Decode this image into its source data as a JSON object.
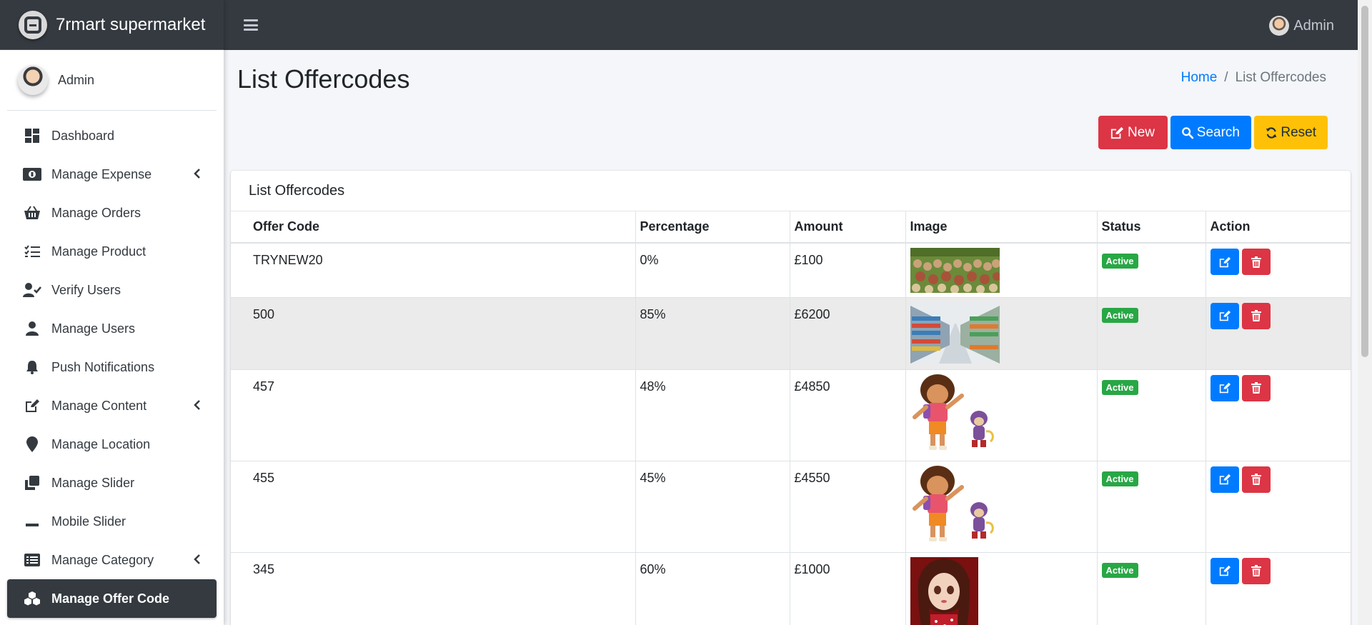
{
  "brand": {
    "name": "7rmart supermarket"
  },
  "sidebar": {
    "user_name": "Admin",
    "items": [
      {
        "label": "Dashboard",
        "icon": "dashboard-icon",
        "has_submenu": false,
        "active": false
      },
      {
        "label": "Manage Expense",
        "icon": "money-icon",
        "has_submenu": true,
        "active": false
      },
      {
        "label": "Manage Orders",
        "icon": "basket-icon",
        "has_submenu": false,
        "active": false
      },
      {
        "label": "Manage Product",
        "icon": "tasks-icon",
        "has_submenu": false,
        "active": false
      },
      {
        "label": "Verify Users",
        "icon": "user-check-icon",
        "has_submenu": false,
        "active": false
      },
      {
        "label": "Manage Users",
        "icon": "user-icon",
        "has_submenu": false,
        "active": false
      },
      {
        "label": "Push Notifications",
        "icon": "bell-icon",
        "has_submenu": false,
        "active": false
      },
      {
        "label": "Manage Content",
        "icon": "edit-icon",
        "has_submenu": true,
        "active": false
      },
      {
        "label": "Manage Location",
        "icon": "map-marker-icon",
        "has_submenu": false,
        "active": false
      },
      {
        "label": "Manage Slider",
        "icon": "clone-icon",
        "has_submenu": false,
        "active": false
      },
      {
        "label": "Mobile Slider",
        "icon": "minus-icon",
        "has_submenu": false,
        "active": false
      },
      {
        "label": "Manage Category",
        "icon": "list-alt-icon",
        "has_submenu": true,
        "active": false
      },
      {
        "label": "Manage Offer Code",
        "icon": "cubes-icon",
        "has_submenu": false,
        "active": true
      }
    ]
  },
  "topbar": {
    "user_name": "Admin"
  },
  "page": {
    "title": "List Offercodes",
    "breadcrumb": {
      "home": "Home",
      "separator": "/",
      "current": "List Offercodes"
    }
  },
  "toolbar": {
    "new_label": "New",
    "search_label": "Search",
    "reset_label": "Reset"
  },
  "card": {
    "title": "List Offercodes"
  },
  "table": {
    "headers": [
      "Offer Code",
      "Percentage",
      "Amount",
      "Image",
      "Status",
      "Action"
    ],
    "rows": [
      {
        "code": "TRYNEW20",
        "percentage": "0%",
        "amount": "£100",
        "image": "grocery-produce-photo",
        "status": "Active"
      },
      {
        "code": "500",
        "percentage": "85%",
        "amount": "£6200",
        "image": "supermarket-aisle-photo",
        "status": "Active"
      },
      {
        "code": "457",
        "percentage": "48%",
        "amount": "£4850",
        "image": "cartoon-girl-and-monkey",
        "status": "Active"
      },
      {
        "code": "455",
        "percentage": "45%",
        "amount": "£4550",
        "image": "cartoon-girl-and-monkey",
        "status": "Active"
      },
      {
        "code": "345",
        "percentage": "60%",
        "amount": "£1000",
        "image": "doll-photo",
        "status": "Active"
      }
    ]
  },
  "colors": {
    "navbar": "#343a40",
    "primary": "#007bff",
    "danger": "#dc3545",
    "warning": "#ffc107",
    "success": "#28a745",
    "content_bg": "#f4f6f9"
  }
}
